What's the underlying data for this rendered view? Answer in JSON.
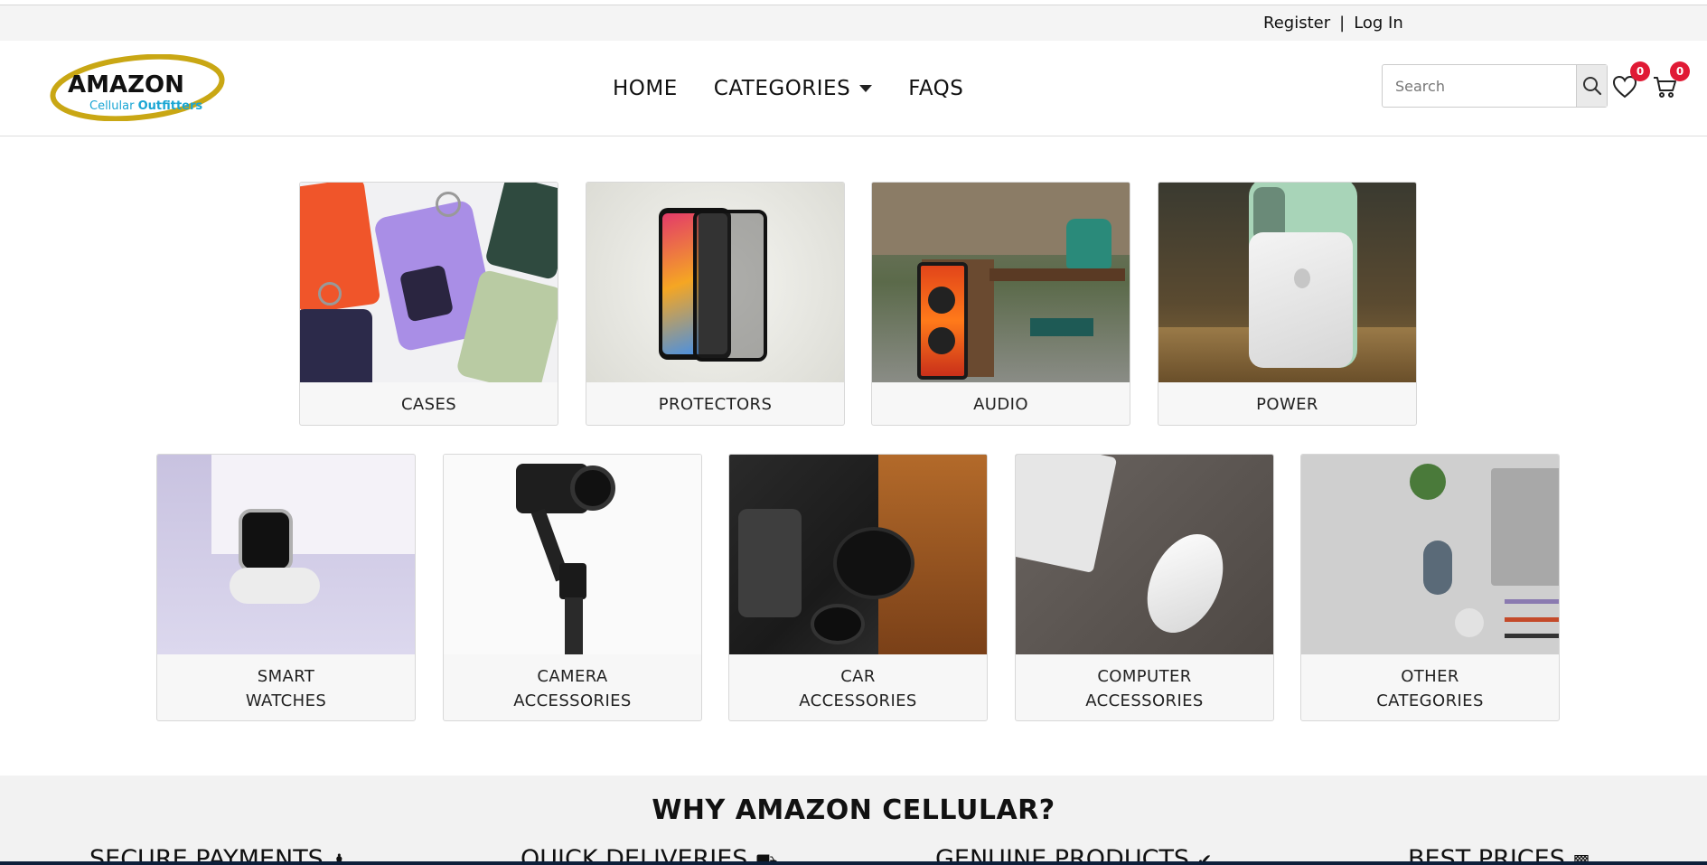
{
  "topbar": {
    "register": "Register",
    "separator": "|",
    "login": "Log In"
  },
  "logo": {
    "brand": "AMAZON",
    "sub_a": "Cellular ",
    "sub_b": "Outfitters"
  },
  "nav": {
    "home": "HOME",
    "categories": "CATEGORIES",
    "faqs": "FAQS"
  },
  "search": {
    "placeholder": "Search"
  },
  "wishlist": {
    "count": "0",
    "icon": "heart-icon"
  },
  "cart": {
    "count": "0",
    "icon": "cart-icon"
  },
  "categories_row1": [
    {
      "label": "CASES"
    },
    {
      "label": "PROTECTORS"
    },
    {
      "label": "AUDIO"
    },
    {
      "label": "POWER"
    }
  ],
  "categories_row2": [
    {
      "label_1": "SMART",
      "label_2": "WATCHES"
    },
    {
      "label_1": "CAMERA",
      "label_2": "ACCESSORIES"
    },
    {
      "label_1": "CAR",
      "label_2": "ACCESSORIES"
    },
    {
      "label_1": "COMPUTER",
      "label_2": "ACCESSORIES"
    },
    {
      "label_1": "OTHER",
      "label_2": "CATEGORIES"
    }
  ],
  "why": {
    "title": "WHY AMAZON CELLULAR?",
    "features": [
      "SECURE PAYMENTS",
      "QUICK DELIVERIES",
      "GENUINE PRODUCTS",
      "BEST PRICES"
    ]
  },
  "colors": {
    "badge": "#e01a35",
    "logo_ring": "#c9a714",
    "logo_sub": "#1aa6d4",
    "footer_band": "#f2f2f2"
  }
}
